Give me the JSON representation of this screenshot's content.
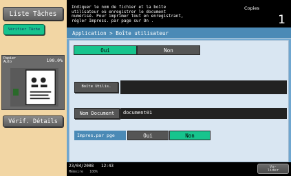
{
  "left": {
    "liste_taches": "Liste Tâches",
    "verifier_tache": "Vérifier Tâche",
    "paper_label": "Papier Auto",
    "zoom": "100.0%",
    "verif_details": "Vérif. Détails"
  },
  "header": {
    "message": "Indiquer le nom de fichier et la boîte\nutilisateur où enregistrer le document\nnumérisé. Pour imprimer tout en enregistrant,\nrégler Impress. par page  sur  On .",
    "copies_label": "Copies",
    "copies_count": "1"
  },
  "breadcrumb": "Application > Boîte utilisateur",
  "toggle_top": {
    "oui": "Oui",
    "non": "Non",
    "selected": "Oui"
  },
  "boite": {
    "label": "Boîte Utilis.",
    "value": ""
  },
  "nom_document": {
    "label": "Nom Document",
    "value": "document01"
  },
  "impres_par_page": {
    "label": "Impres.par pge",
    "oui": "Oui",
    "non": "Non",
    "selected": "Non"
  },
  "status": {
    "date": "23/04/2008",
    "time": "12:43",
    "memory_label": "Mémoire",
    "memory_value": "100%"
  },
  "valider": "Va-\nlider",
  "colors": {
    "accent_green": "#17c48d",
    "panel_blue": "#6fa6cf",
    "header_blue": "#4b8ab6"
  }
}
